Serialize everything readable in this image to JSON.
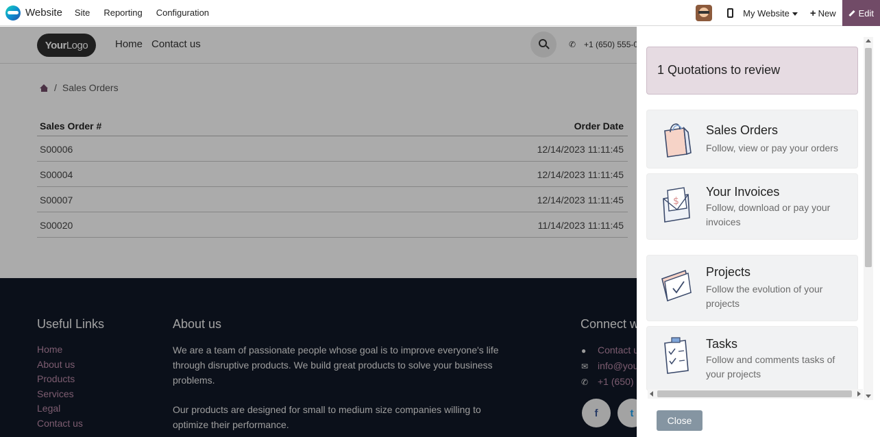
{
  "topbar": {
    "app_name": "Website",
    "menus": [
      "Site",
      "Reporting",
      "Configuration"
    ],
    "site_selector": "My Website",
    "new_label": "New",
    "edit_label": "Edit"
  },
  "site": {
    "logo": {
      "your": "Your",
      "logo": "Logo"
    },
    "nav": [
      "Home",
      "Contact us"
    ],
    "phone": "+1 (650) 555-0"
  },
  "breadcrumb": {
    "current": "Sales Orders",
    "separator": "/"
  },
  "orders": {
    "headers": [
      "Sales Order #",
      "Order Date"
    ],
    "rows": [
      {
        "number": "S00006",
        "date": "12/14/2023  11:11:45"
      },
      {
        "number": "S00004",
        "date": "12/14/2023  11:11:45"
      },
      {
        "number": "S00007",
        "date": "12/14/2023  11:11:45"
      },
      {
        "number": "S00020",
        "date": "11/14/2023  11:11:45"
      }
    ]
  },
  "footer": {
    "useful_links_title": "Useful Links",
    "links": [
      "Home",
      "About us",
      "Products",
      "Services",
      "Legal",
      "Contact us"
    ],
    "about_title": "About us",
    "about_p1": "We are a team of passionate people whose goal is to improve everyone's life through disruptive products. We build great products to solve your business problems.",
    "about_p2": "Our products are designed for small to medium size companies willing to optimize their performance.",
    "connect_title": "Connect w",
    "connect": [
      "Contact u",
      "info@you",
      "+1 (650)"
    ],
    "social": [
      "f",
      "t"
    ]
  },
  "panel": {
    "banner": "1  Quotations to review",
    "cards": [
      {
        "title": "Sales Orders",
        "subtitle": "Follow, view or pay your orders",
        "icon": "shopping-bag-icon"
      },
      {
        "title": "Your Invoices",
        "subtitle": "Follow, download or pay your invoices",
        "icon": "invoice-envelope-icon"
      },
      {
        "title": "Projects",
        "subtitle": "Follow the evolution of your projects",
        "icon": "project-folder-icon"
      },
      {
        "title": "Tasks",
        "subtitle": "Follow and comments tasks of your projects",
        "icon": "task-checklist-icon"
      }
    ],
    "close_label": "Close"
  },
  "colors": {
    "accent": "#714b67",
    "footer_bg": "#111827",
    "banner_bg": "#e6dbe2",
    "close_bg": "#8595a2"
  }
}
